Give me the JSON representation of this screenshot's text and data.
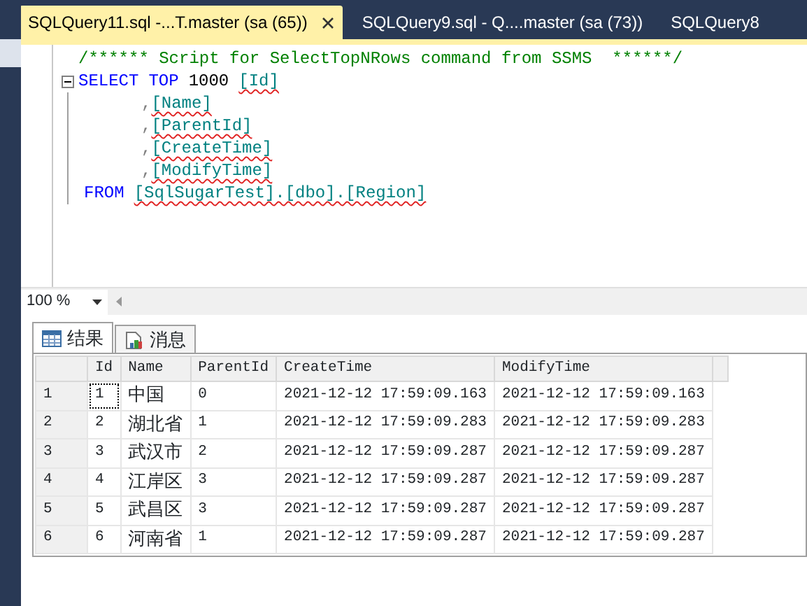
{
  "document_tabs": [
    {
      "label": "SQLQuery11.sql -...T.master (sa (65))",
      "selected": true
    },
    {
      "label": "SQLQuery9.sql - Q....master (sa (73))",
      "selected": false
    },
    {
      "label": "SQLQuery8",
      "selected": false
    }
  ],
  "editor": {
    "lines": [
      {
        "kind": "comment",
        "tokens": [
          {
            "kind": "comment",
            "text": "/****** Script for SelectTopNRows command from SSMS  ******/"
          }
        ]
      },
      {
        "kind": "select",
        "tokens": [
          {
            "kind": "keyword",
            "text": "SELECT"
          },
          {
            "kind": "keyword",
            "text": "TOP"
          },
          {
            "kind": "plain",
            "text": "1000"
          },
          {
            "kind": "identifier",
            "text": "[Id]"
          }
        ]
      },
      {
        "kind": "column",
        "tokens": [
          {
            "kind": "punct",
            "text": ","
          },
          {
            "kind": "identifier",
            "text": "[Name]"
          }
        ]
      },
      {
        "kind": "column",
        "tokens": [
          {
            "kind": "punct",
            "text": ","
          },
          {
            "kind": "identifier",
            "text": "[ParentId]"
          }
        ]
      },
      {
        "kind": "column",
        "tokens": [
          {
            "kind": "punct",
            "text": ","
          },
          {
            "kind": "identifier",
            "text": "[CreateTime]"
          }
        ]
      },
      {
        "kind": "column",
        "tokens": [
          {
            "kind": "punct",
            "text": ","
          },
          {
            "kind": "identifier",
            "text": "[ModifyTime]"
          }
        ]
      },
      {
        "kind": "from",
        "tokens": [
          {
            "kind": "keyword",
            "text": "FROM"
          },
          {
            "kind": "identifier",
            "text": "[SqlSugarTest].[dbo].[Region]"
          }
        ]
      }
    ]
  },
  "zoom": "100 %",
  "result_tabs": [
    {
      "label": "结果",
      "kind": "grid",
      "selected": true
    },
    {
      "label": "消息",
      "kind": "messages",
      "selected": false
    }
  ],
  "grid": {
    "columns": [
      "Id",
      "Name",
      "ParentId",
      "CreateTime",
      "ModifyTime"
    ],
    "rows": [
      {
        "number": "1",
        "cells": [
          {
            "text": "1",
            "focused": true
          },
          {
            "text": "中国",
            "focused": false
          },
          {
            "text": "0",
            "focused": false
          },
          {
            "text": "2021-12-12 17:59:09.163",
            "focused": false
          },
          {
            "text": "2021-12-12 17:59:09.163",
            "focused": false
          }
        ]
      },
      {
        "number": "2",
        "cells": [
          {
            "text": "2",
            "focused": false
          },
          {
            "text": "湖北省",
            "focused": false
          },
          {
            "text": "1",
            "focused": false
          },
          {
            "text": "2021-12-12 17:59:09.283",
            "focused": false
          },
          {
            "text": "2021-12-12 17:59:09.283",
            "focused": false
          }
        ]
      },
      {
        "number": "3",
        "cells": [
          {
            "text": "3",
            "focused": false
          },
          {
            "text": "武汉市",
            "focused": false
          },
          {
            "text": "2",
            "focused": false
          },
          {
            "text": "2021-12-12 17:59:09.287",
            "focused": false
          },
          {
            "text": "2021-12-12 17:59:09.287",
            "focused": false
          }
        ]
      },
      {
        "number": "4",
        "cells": [
          {
            "text": "4",
            "focused": false
          },
          {
            "text": "江岸区",
            "focused": false
          },
          {
            "text": "3",
            "focused": false
          },
          {
            "text": "2021-12-12 17:59:09.287",
            "focused": false
          },
          {
            "text": "2021-12-12 17:59:09.287",
            "focused": false
          }
        ]
      },
      {
        "number": "5",
        "cells": [
          {
            "text": "5",
            "focused": false
          },
          {
            "text": "武昌区",
            "focused": false
          },
          {
            "text": "3",
            "focused": false
          },
          {
            "text": "2021-12-12 17:59:09.287",
            "focused": false
          },
          {
            "text": "2021-12-12 17:59:09.287",
            "focused": false
          }
        ]
      },
      {
        "number": "6",
        "cells": [
          {
            "text": "6",
            "focused": false
          },
          {
            "text": "河南省",
            "focused": false
          },
          {
            "text": "1",
            "focused": false
          },
          {
            "text": "2021-12-12 17:59:09.287",
            "focused": false
          },
          {
            "text": "2021-12-12 17:59:09.287",
            "focused": false
          }
        ]
      }
    ]
  }
}
